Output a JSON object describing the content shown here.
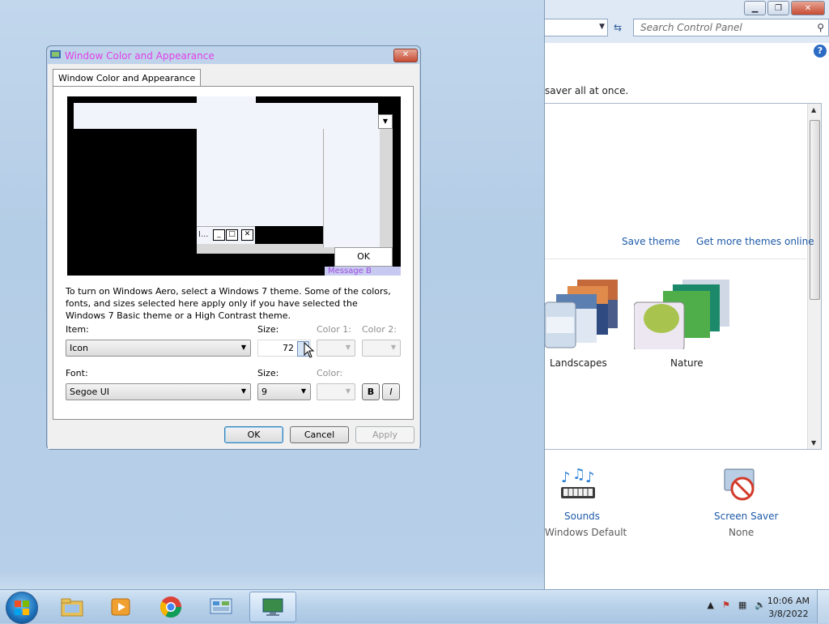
{
  "control_panel": {
    "search_placeholder": "Search Control Panel",
    "help": "?",
    "description": "saver all at once.",
    "links": {
      "save_theme": "Save theme",
      "more_themes": "Get more themes online"
    },
    "themes": [
      {
        "name": "Landscapes"
      },
      {
        "name": "Nature"
      }
    ],
    "items": [
      {
        "label": "Sounds",
        "sub": "Windows Default"
      },
      {
        "label": "Screen Saver",
        "sub": "None"
      }
    ]
  },
  "dialog": {
    "title": "Window Color and Appearance",
    "tab_label": "Window Color and Appearance",
    "preview": {
      "ok_label": "OK",
      "message_label": "Message B",
      "inactive_caption": "I..."
    },
    "info_text": "To turn on Windows Aero, select a Windows 7 theme.  Some of the colors, fonts, and sizes selected here apply only if you have selected the Windows 7 Basic theme or a High Contrast theme.",
    "item_label": "Item:",
    "item_value": "Icon",
    "size_label": "Size:",
    "size_value": "72",
    "color1_label": "Color 1:",
    "color2_label": "Color 2:",
    "font_label": "Font:",
    "font_value": "Segoe UI",
    "font_size_label": "Size:",
    "font_size_value": "9",
    "font_color_label": "Color:",
    "bold_label": "B",
    "italic_label": "I",
    "buttons": {
      "ok": "OK",
      "cancel": "Cancel",
      "apply": "Apply"
    }
  },
  "taskbar": {
    "clock_time": "10:06 AM",
    "clock_date": "3/8/2022"
  },
  "colors": {
    "link": "#1e5aa8",
    "dialog_title": "#e040e8"
  }
}
